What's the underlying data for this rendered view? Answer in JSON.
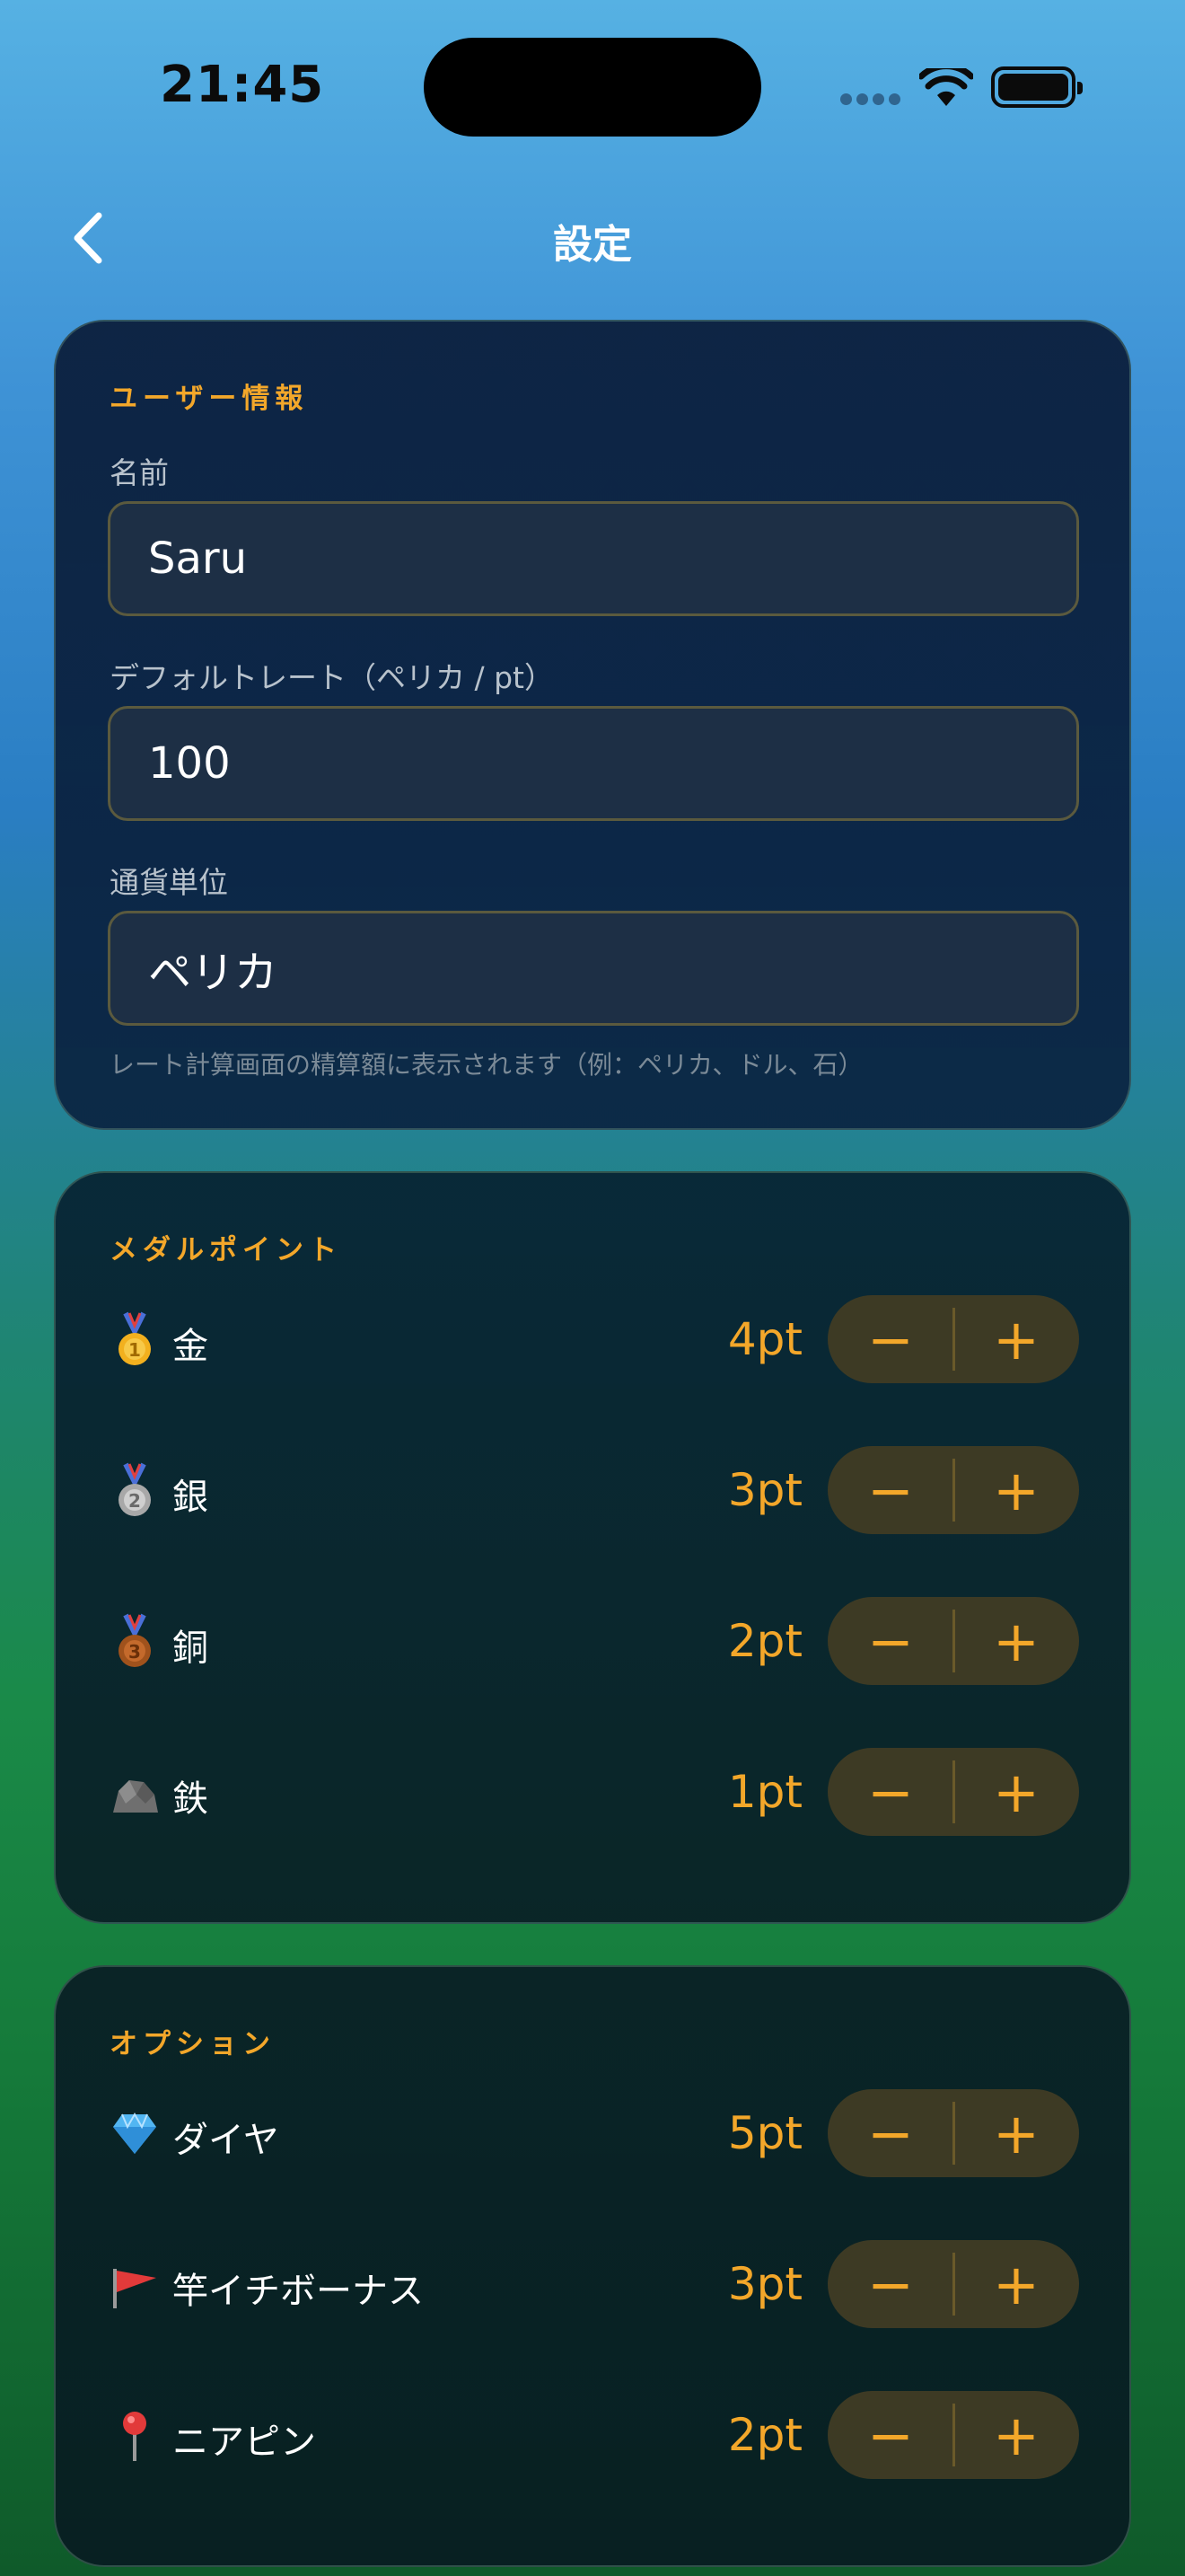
{
  "status": {
    "time": "21:45"
  },
  "nav": {
    "title": "設定"
  },
  "user_section": {
    "title": "ユーザー情報",
    "name_label": "名前",
    "name_value": "Saru",
    "rate_label": "デフォルトレート（ペリカ / pt）",
    "rate_value": "100",
    "currency_label": "通貨単位",
    "currency_value": "ペリカ",
    "hint": "レート計算画面の精算額に表示されます（例：ペリカ、ドル、石）"
  },
  "medal_section": {
    "title": "メダルポイント",
    "items": [
      {
        "label": "金",
        "value": "4pt",
        "icon": "gold-medal-icon"
      },
      {
        "label": "銀",
        "value": "3pt",
        "icon": "silver-medal-icon"
      },
      {
        "label": "銅",
        "value": "2pt",
        "icon": "bronze-medal-icon"
      },
      {
        "label": "鉄",
        "value": "1pt",
        "icon": "rock-icon"
      }
    ]
  },
  "option_section": {
    "title": "オプション",
    "items": [
      {
        "label": "ダイヤ",
        "value": "5pt",
        "icon": "diamond-icon"
      },
      {
        "label": "竿イチボーナス",
        "value": "3pt",
        "icon": "red-flag-icon"
      },
      {
        "label": "ニアピン",
        "value": "2pt",
        "icon": "pin-icon"
      }
    ]
  },
  "stepper": {
    "minus": "−",
    "plus": "+"
  },
  "colors": {
    "accent": "#f3a72a",
    "card": "#0c203e",
    "stepper": "#3d3a24"
  }
}
